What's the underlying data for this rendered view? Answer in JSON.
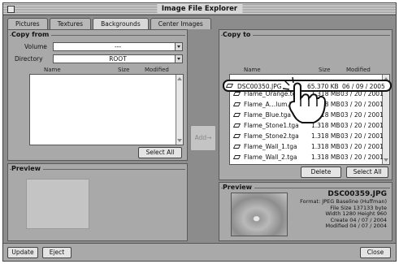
{
  "window": {
    "title": "Image File Explorer"
  },
  "tabs": [
    {
      "label": "Pictures",
      "active": false
    },
    {
      "label": "Textures",
      "active": false
    },
    {
      "label": "Backgrounds",
      "active": true
    },
    {
      "label": "Center Images",
      "active": false
    }
  ],
  "copy_from": {
    "title": "Copy from",
    "volume_label": "Volume",
    "volume_value": "---",
    "directory_label": "Directory",
    "directory_value": "ROOT",
    "columns": {
      "name": "Name",
      "size": "Size",
      "modified": "Modified"
    },
    "select_all_label": "Select All",
    "preview_title": "Preview"
  },
  "add_button_label": "Add→",
  "copy_to": {
    "title": "Copy to",
    "columns": {
      "name": "Name",
      "size": "Size",
      "modified": "Modified"
    },
    "files": [
      {
        "name": "DSC00350.JPG",
        "size": "65.370 KB",
        "modified": "06 / 09 / 2005",
        "highlighted": true
      },
      {
        "name": "Flame_Orange.tga",
        "size": "1.318 MB",
        "modified": "03 / 20 / 2001",
        "highlighted": false
      },
      {
        "name": "Flame_A…lum.tga",
        "size": "1.318 MB",
        "modified": "03 / 20 / 2001",
        "highlighted": false
      },
      {
        "name": "Flame_Blue.tga",
        "size": "1.318 MB",
        "modified": "03 / 20 / 2001",
        "highlighted": false
      },
      {
        "name": "Flame_Stone1.tga",
        "size": "1.318 MB",
        "modified": "03 / 20 / 2001",
        "highlighted": false
      },
      {
        "name": "Flame_Stone2.tga",
        "size": "1.318 MB",
        "modified": "03 / 20 / 2001",
        "highlighted": false
      },
      {
        "name": "Flame_Wall_1.tga",
        "size": "1.318 MB",
        "modified": "03 / 20 / 2001",
        "highlighted": false
      },
      {
        "name": "Flame_Wall_2.tga",
        "size": "1.318 MB",
        "modified": "03 / 20 / 2001",
        "highlighted": false
      }
    ],
    "delete_label": "Delete",
    "select_all_label": "Select All",
    "preview_title": "Preview",
    "preview_info": {
      "filename": "DSC00359.JPG",
      "format": "Format: JPEG Baseline (Huffman)",
      "file_size": "File Size 137133 byte",
      "dimensions": "Width 1280 Height 960",
      "created": "Create 04 / 07 / 2004",
      "modified": "Modified 04 / 07 / 2004"
    }
  },
  "bottom": {
    "update_label": "Update",
    "eject_label": "Eject",
    "close_label": "Close"
  }
}
